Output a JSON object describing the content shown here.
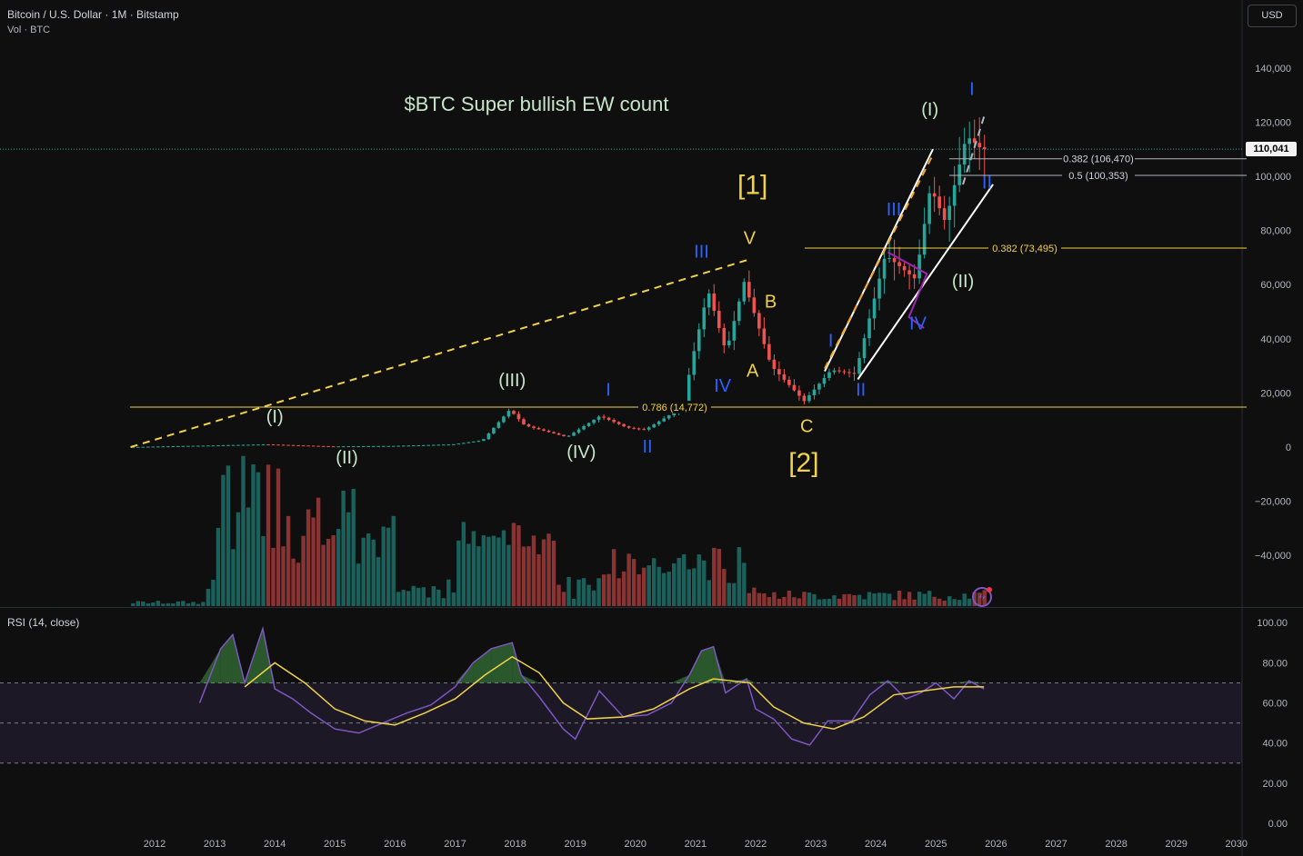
{
  "header": {
    "symbol": "Bitcoin / U.S. Dollar · 1M · Bitstamp",
    "volume_label": "Vol · BTC"
  },
  "currency_button": "USD",
  "current_price_label": "110,041",
  "rsi_label": "RSI (14, close)",
  "chart_data": [
    {
      "type": "candlestick",
      "title": "$BTC Super bullish EW count",
      "price_axis_ticks": [
        "140,000",
        "120,000",
        "100,000",
        "80,000",
        "60,000",
        "40,000",
        "20,000",
        "0",
        "−20,000",
        "−40,000"
      ],
      "price_axis_values": [
        140000,
        120000,
        100000,
        80000,
        60000,
        40000,
        20000,
        0,
        -20000,
        -40000
      ],
      "ylim": [
        -57000,
        150000
      ],
      "time_axis_labels": [
        "2012",
        "2013",
        "2014",
        "2015",
        "2016",
        "2017",
        "2018",
        "2019",
        "2020",
        "2021",
        "2022",
        "2023",
        "2024",
        "2025",
        "2026",
        "2027",
        "2028",
        "2029",
        "2030"
      ],
      "time_axis_years": [
        2012,
        2013,
        2014,
        2015,
        2016,
        2017,
        2018,
        2019,
        2020,
        2021,
        2022,
        2023,
        2024,
        2025,
        2026,
        2027,
        2028,
        2029,
        2030
      ],
      "key_points": [
        {
          "t": 2011.6,
          "v": 5
        },
        {
          "t": 2013.9,
          "v": 1000
        },
        {
          "t": 2015.0,
          "v": 250
        },
        {
          "t": 2016.0,
          "v": 430
        },
        {
          "t": 2017.0,
          "v": 1000
        },
        {
          "t": 2017.5,
          "v": 2500
        },
        {
          "t": 2017.95,
          "v": 13800
        },
        {
          "t": 2018.2,
          "v": 8000
        },
        {
          "t": 2018.9,
          "v": 3700
        },
        {
          "t": 2019.45,
          "v": 11500
        },
        {
          "t": 2019.9,
          "v": 7200
        },
        {
          "t": 2020.2,
          "v": 6400
        },
        {
          "t": 2020.85,
          "v": 15000
        },
        {
          "t": 2020.95,
          "v": 29000
        },
        {
          "t": 2021.25,
          "v": 58000
        },
        {
          "t": 2021.55,
          "v": 35000
        },
        {
          "t": 2021.85,
          "v": 61000
        },
        {
          "t": 2022.3,
          "v": 30000
        },
        {
          "t": 2022.85,
          "v": 17000
        },
        {
          "t": 2023.3,
          "v": 28500
        },
        {
          "t": 2023.7,
          "v": 27000
        },
        {
          "t": 2024.2,
          "v": 71000
        },
        {
          "t": 2024.7,
          "v": 62000
        },
        {
          "t": 2024.95,
          "v": 96000
        },
        {
          "t": 2025.2,
          "v": 83000
        },
        {
          "t": 2025.55,
          "v": 115000
        },
        {
          "t": 2025.8,
          "v": 110041
        }
      ],
      "levels": [
        {
          "label": "0.786 (14,772)",
          "value": 14772,
          "color": "#f0d24b"
        },
        {
          "label": "0.382 (73,495)",
          "value": 73495,
          "color": "#f0d24b"
        },
        {
          "label": "0.382 (106,470)",
          "value": 106470,
          "color": "#b2b5be"
        },
        {
          "label": "0.5 (100,353)",
          "value": 100353,
          "color": "#b2b5be"
        }
      ],
      "trendlines": [
        {
          "from": {
            "t": 2011.6,
            "v": 0
          },
          "to": {
            "t": 2021.85,
            "v": 69000
          },
          "style": "dashed",
          "color": "#f0d24b"
        },
        {
          "from": {
            "t": 2023.15,
            "v": 28000
          },
          "to": {
            "t": 2024.95,
            "v": 110000
          },
          "style": "solid",
          "color": "#ffffff"
        },
        {
          "from": {
            "t": 2023.15,
            "v": 29000
          },
          "to": {
            "t": 2024.95,
            "v": 108000
          },
          "style": "dashed",
          "color": "#f5a623"
        },
        {
          "from": {
            "t": 2023.7,
            "v": 25000
          },
          "to": {
            "t": 2025.95,
            "v": 97000
          },
          "style": "solid",
          "color": "#ffffff"
        },
        {
          "from": {
            "t": 2025.45,
            "v": 97000
          },
          "to": {
            "t": 2025.8,
            "v": 122000
          },
          "style": "dashed",
          "color": "#b2b5be"
        }
      ],
      "wave_labels": [
        {
          "text": "(I)",
          "t": 2014.0,
          "v": 9000,
          "color": "#c8e6c9",
          "size": 20
        },
        {
          "text": "(II)",
          "t": 2015.2,
          "v": -6000,
          "color": "#c8e6c9",
          "size": 20
        },
        {
          "text": "(III)",
          "t": 2017.95,
          "v": 22500,
          "color": "#c8e6c9",
          "size": 20
        },
        {
          "text": "(IV)",
          "t": 2019.1,
          "v": -4000,
          "color": "#c8e6c9",
          "size": 20
        },
        {
          "text": "I",
          "t": 2019.55,
          "v": 19000,
          "color": "#2962ff",
          "size": 20
        },
        {
          "text": "II",
          "t": 2020.2,
          "v": -2000,
          "color": "#2962ff",
          "size": 20
        },
        {
          "text": "III",
          "t": 2021.1,
          "v": 70000,
          "color": "#2962ff",
          "size": 20
        },
        {
          "text": "IV",
          "t": 2021.45,
          "v": 20500,
          "color": "#2962ff",
          "size": 20
        },
        {
          "text": "V",
          "t": 2021.9,
          "v": 75000,
          "color": "#f0d24b",
          "size": 20
        },
        {
          "text": "[1]",
          "t": 2021.95,
          "v": 93500,
          "color": "#f0d24b",
          "size": 30
        },
        {
          "text": "A",
          "t": 2021.95,
          "v": 26000,
          "color": "#f0d24b",
          "size": 20
        },
        {
          "text": "B",
          "t": 2022.25,
          "v": 51500,
          "color": "#f0d24b",
          "size": 20
        },
        {
          "text": "C",
          "t": 2022.85,
          "v": 5500,
          "color": "#f0d24b",
          "size": 20
        },
        {
          "text": "[2]",
          "t": 2022.8,
          "v": -9000,
          "color": "#f0d24b",
          "size": 30
        },
        {
          "text": "I",
          "t": 2023.25,
          "v": 37000,
          "color": "#2962ff",
          "size": 20
        },
        {
          "text": "II",
          "t": 2023.75,
          "v": 19000,
          "color": "#2962ff",
          "size": 20
        },
        {
          "text": "III",
          "t": 2024.3,
          "v": 85500,
          "color": "#2962ff",
          "size": 20
        },
        {
          "text": "IV",
          "t": 2024.7,
          "v": 43500,
          "color": "#2962ff",
          "size": 20
        },
        {
          "text": "(I)",
          "t": 2024.9,
          "v": 122500,
          "color": "#c8e6c9",
          "size": 20
        },
        {
          "text": "(II)",
          "t": 2025.45,
          "v": 59000,
          "color": "#c8e6c9",
          "size": 20
        },
        {
          "text": "I",
          "t": 2025.6,
          "v": 130000,
          "color": "#2962ff",
          "size": 20
        },
        {
          "text": "II",
          "t": 2025.85,
          "v": 95500,
          "color": "#2962ff",
          "size": 20
        }
      ]
    },
    {
      "type": "line",
      "title": "RSI (14, close)",
      "ylim": [
        0,
        100
      ],
      "ticks": [
        "100.00",
        "80.00",
        "60.00",
        "40.00",
        "20.00",
        "0.00"
      ],
      "tick_values": [
        100,
        80,
        60,
        40,
        20,
        0
      ],
      "band": [
        30,
        70
      ],
      "midline": 50,
      "series": [
        {
          "name": "rsi",
          "color": "#7e57c2",
          "points": [
            [
              2012.75,
              60
            ],
            [
              2013.1,
              87
            ],
            [
              2013.3,
              94
            ],
            [
              2013.5,
              70
            ],
            [
              2013.8,
              97
            ],
            [
              2014.0,
              67
            ],
            [
              2014.3,
              62
            ],
            [
              2014.6,
              55
            ],
            [
              2015.0,
              47
            ],
            [
              2015.4,
              45
            ],
            [
              2015.8,
              50
            ],
            [
              2016.2,
              55
            ],
            [
              2016.6,
              59
            ],
            [
              2017.0,
              68
            ],
            [
              2017.3,
              80
            ],
            [
              2017.6,
              87
            ],
            [
              2017.95,
              90
            ],
            [
              2018.1,
              74
            ],
            [
              2018.4,
              63
            ],
            [
              2018.8,
              47
            ],
            [
              2019.0,
              42
            ],
            [
              2019.4,
              66
            ],
            [
              2019.8,
              53
            ],
            [
              2020.2,
              54
            ],
            [
              2020.6,
              60
            ],
            [
              2020.9,
              74
            ],
            [
              2021.1,
              86
            ],
            [
              2021.3,
              88
            ],
            [
              2021.5,
              65
            ],
            [
              2021.85,
              72
            ],
            [
              2022.0,
              57
            ],
            [
              2022.3,
              52
            ],
            [
              2022.6,
              42
            ],
            [
              2022.9,
              39
            ],
            [
              2023.2,
              51
            ],
            [
              2023.6,
              51
            ],
            [
              2023.9,
              64
            ],
            [
              2024.2,
              71
            ],
            [
              2024.5,
              62
            ],
            [
              2024.75,
              65
            ],
            [
              2025.0,
              70
            ],
            [
              2025.3,
              62
            ],
            [
              2025.55,
              71
            ],
            [
              2025.8,
              67
            ]
          ]
        },
        {
          "name": "ma",
          "color": "#f0d24b",
          "points": [
            [
              2013.5,
              68
            ],
            [
              2014.0,
              80
            ],
            [
              2014.5,
              70
            ],
            [
              2015.0,
              57
            ],
            [
              2015.5,
              51
            ],
            [
              2016.0,
              49
            ],
            [
              2016.5,
              55
            ],
            [
              2017.0,
              62
            ],
            [
              2017.5,
              74
            ],
            [
              2017.95,
              83
            ],
            [
              2018.4,
              75
            ],
            [
              2018.8,
              60
            ],
            [
              2019.2,
              52
            ],
            [
              2019.8,
              53
            ],
            [
              2020.3,
              57
            ],
            [
              2020.9,
              67
            ],
            [
              2021.3,
              72
            ],
            [
              2021.9,
              70
            ],
            [
              2022.3,
              58
            ],
            [
              2022.8,
              50
            ],
            [
              2023.3,
              47
            ],
            [
              2023.8,
              53
            ],
            [
              2024.3,
              64
            ],
            [
              2024.8,
              66
            ],
            [
              2025.3,
              68
            ],
            [
              2025.8,
              68
            ]
          ]
        }
      ]
    }
  ]
}
